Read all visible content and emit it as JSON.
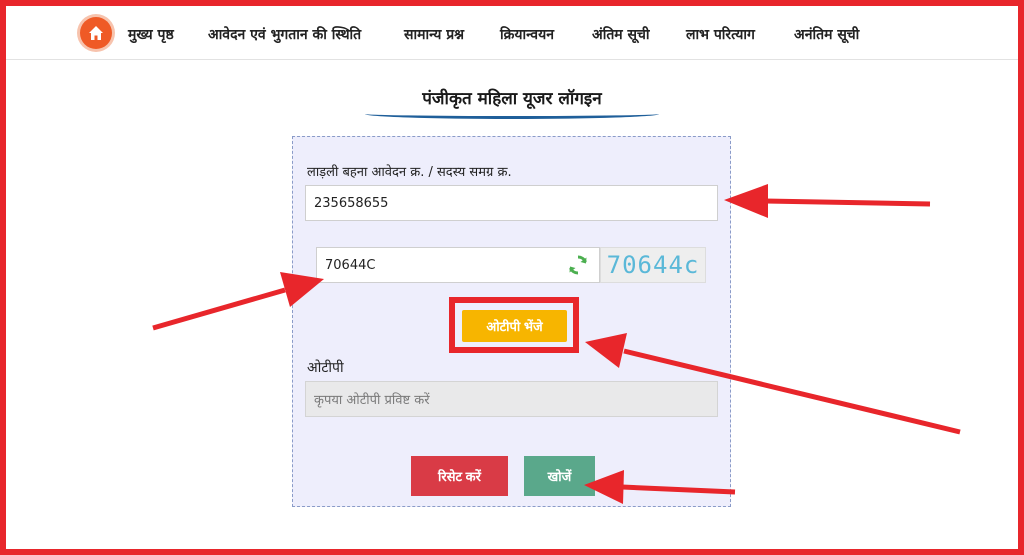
{
  "nav": {
    "home_icon": "home-icon",
    "items": [
      {
        "label": "मुख्य पृष्ठ"
      },
      {
        "label": "आवेदन एवं भुगतान की स्थिति"
      },
      {
        "label": "सामान्य प्रश्न"
      },
      {
        "label": "क्रियान्वयन"
      },
      {
        "label": "अंतिम सूची"
      },
      {
        "label": "लाभ परित्याग"
      },
      {
        "label": "अनंतिम सूची"
      }
    ]
  },
  "page": {
    "title": "पंजीकृत महिला यूजर लॉगइन"
  },
  "form": {
    "app_number_label": "लाड़ली बहना आवेदन क्र. / सदस्य समग्र क्र.",
    "app_number_value": "235658655",
    "captcha_input_value": "70644C",
    "captcha_image_text": "70644c",
    "refresh_icon": "refresh-icon",
    "send_otp_label": "ओटीपी भेंजे",
    "otp_label": "ओटीपी",
    "otp_placeholder": "कृपया ओटीपी प्रविष्ट करें",
    "reset_label": "रिसेट करें",
    "search_label": "खोजें"
  },
  "colors": {
    "frame_red": "#e8262b",
    "home_orange": "#ef5a26",
    "otp_button": "#f7b500",
    "reset_button": "#d93b46",
    "search_button": "#5aa88b",
    "panel_bg": "#eeeefc"
  }
}
